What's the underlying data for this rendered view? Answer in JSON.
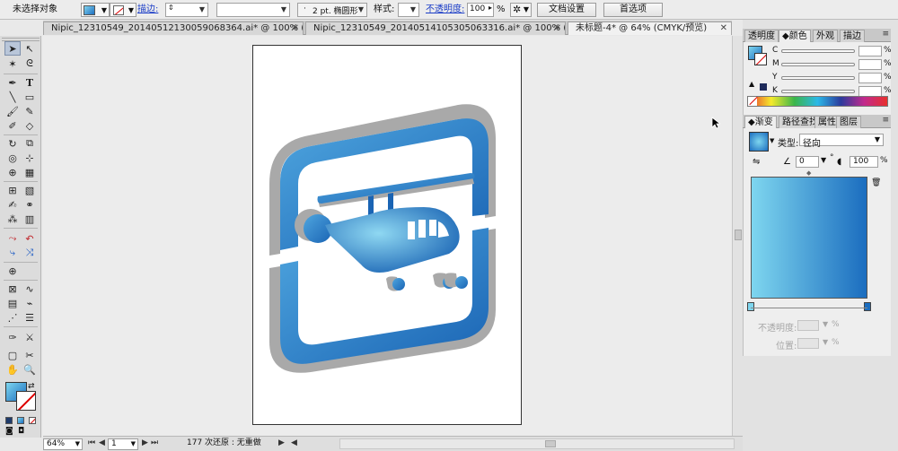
{
  "control_bar": {
    "no_selection": "未选择对象",
    "stroke_label": "描边:",
    "brush_value": "2 pt. 椭圆形",
    "style_label": "样式:",
    "opacity_label": "不透明度:",
    "opacity_value": "100",
    "opacity_unit": "%",
    "doc_setup": "文档设置",
    "preferences": "首选项"
  },
  "tabs": [
    {
      "label": "Nipic_12310549_20140512130059068364.ai* @ 100% (R..."
    },
    {
      "label": "Nipic_12310549_20140514105305063316.ai* @ 100% (R..."
    },
    {
      "label": "未标题-4* @ 64% (CMYK/预览)"
    }
  ],
  "status": {
    "zoom": "64%",
    "page": "1",
    "undo_text": "177 次还原 : 无重做"
  },
  "color_panel": {
    "tabs": [
      "透明度",
      "颜色",
      "外观",
      "描边"
    ],
    "channels": [
      {
        "name": "C",
        "value": "",
        "unit": "%"
      },
      {
        "name": "M",
        "value": "",
        "unit": "%"
      },
      {
        "name": "Y",
        "value": "",
        "unit": "%"
      },
      {
        "name": "K",
        "value": "",
        "unit": "%"
      }
    ]
  },
  "gradient_panel": {
    "tabs": [
      "渐变",
      "路径查找",
      "属性",
      "图层"
    ],
    "type_label": "类型:",
    "type_value": "径向",
    "angle_value": "0",
    "angle_unit": "°",
    "ratio_value": "100",
    "ratio_unit": "%",
    "opacity_label": "不透明度:",
    "location_label": "位置:",
    "unit": "%",
    "colors": {
      "start": "#7ed6ef",
      "end": "#1b6dbf"
    }
  },
  "artwork": {
    "colors": {
      "blue_light": "#4aa3dc",
      "blue_dark": "#1a64b4",
      "gray": "#a9a9a9"
    }
  }
}
